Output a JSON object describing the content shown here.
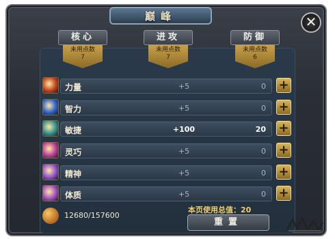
{
  "window": {
    "title": "巅峰",
    "close_label": "✕"
  },
  "tabs": [
    {
      "label": "核心",
      "unused_label": "未用点数",
      "unused_points": "7"
    },
    {
      "label": "进攻",
      "unused_label": "未用点数",
      "unused_points": "7"
    },
    {
      "label": "防御",
      "unused_label": "未用点数",
      "unused_points": "6"
    }
  ],
  "stats": [
    {
      "name": "力量",
      "bonus": "+5",
      "points": "0",
      "icon": "strength-fist-icon",
      "highlight": false,
      "icon_color": "#c0401c"
    },
    {
      "name": "智力",
      "bonus": "+5",
      "points": "0",
      "icon": "intelligence-orb-icon",
      "highlight": false,
      "icon_color": "#2b5fd0"
    },
    {
      "name": "敏捷",
      "bonus": "+100",
      "points": "20",
      "icon": "agility-boot-icon",
      "highlight": true,
      "icon_color": "#2d8f8f"
    },
    {
      "name": "灵巧",
      "bonus": "+5",
      "points": "0",
      "icon": "dexterity-hand-icon",
      "highlight": false,
      "icon_color": "#b83c9a"
    },
    {
      "name": "精神",
      "bonus": "+5",
      "points": "0",
      "icon": "spirit-rune-icon",
      "highlight": false,
      "icon_color": "#8e4fd0"
    },
    {
      "name": "体质",
      "bonus": "+5",
      "points": "0",
      "icon": "constitution-body-icon",
      "highlight": false,
      "icon_color": "#a04fc0"
    }
  ],
  "plus_label": "+",
  "footer": {
    "experience": "12680/157600",
    "total_label": "本页使用总值：20",
    "reset_label": "重置"
  },
  "colors": {
    "gold": "#d8b55c",
    "panel": "#2b3a4a",
    "text": "#f2ead4"
  }
}
